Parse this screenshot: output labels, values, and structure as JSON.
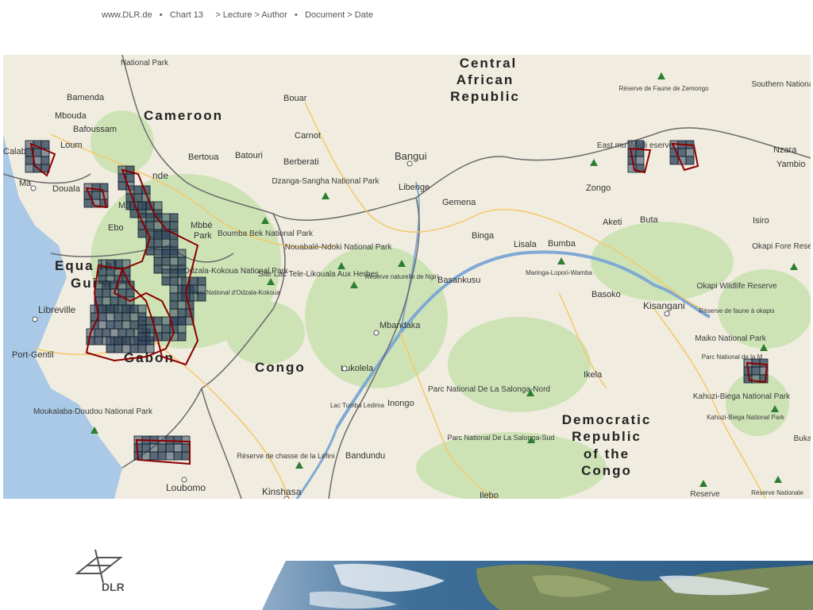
{
  "header": {
    "site": "www.DLR.de",
    "sep1": "•",
    "chart": "Chart 13",
    "lecture": "> Lecture > Author",
    "sep2": "•",
    "doc": "Document > Date"
  },
  "map": {
    "countries": [
      {
        "id": "central-african-republic",
        "lines": [
          "Central",
          "African",
          "Republic"
        ]
      },
      {
        "id": "cameroon",
        "lines": [
          "Cameroon"
        ]
      },
      {
        "id": "equatorial-guinea",
        "lines": [
          "Equa    ial",
          "Gui   a"
        ]
      },
      {
        "id": "gabon",
        "lines": [
          "Gabon"
        ]
      },
      {
        "id": "congo",
        "lines": [
          "Congo"
        ]
      },
      {
        "id": "drc",
        "lines": [
          "Democratic",
          "Republic",
          "of the",
          "Congo"
        ]
      }
    ],
    "cities": [
      "Bangui",
      "Bamenda",
      "Mbouda",
      "Bafoussam",
      "Loum",
      "Douala",
      "Calab",
      "Ma",
      "Bertoua",
      "Batouri",
      "Bouar",
      "Carnot",
      "Berberati",
      "Libenge",
      "Gemena",
      "Zongo",
      "Binga",
      "Lisala",
      "Bumba",
      "Aketi",
      "Buta",
      "Isiro",
      "Nzara",
      "Yambio",
      "Basankusu",
      "Basoko",
      "Kisangani",
      "Mbandaka",
      "Lukolela",
      "Inongo",
      "Ikela",
      "Libreville",
      "Port-Gentil",
      "Bandundu",
      "Kinshasa",
      "Loubomo",
      "Ilebo",
      "nde",
      "Mb",
      "Ebo",
      "Mbbé",
      "Park",
      "Mbandaka"
    ],
    "parks": [
      "National Park",
      "Dzanga-Sangha National Park",
      "Boumba Bek National Park",
      "Nouabalé-Ndoki National Park",
      "Site Lac Tele-Likouala Aux Herbes",
      "Odzala-Kokoua National Park",
      "Parc National d'Odzala-Kokoua",
      "Réserve naturelle de Ngiri",
      "Maringa-Lopori-Wamba",
      "Okapi Fore Reserve",
      "Okapi Wildlife Reserve",
      "Réserve de faune à okapis",
      "Maiko National Park",
      "Parc National de la M",
      "Kahuzi-Biega National Park",
      "Kahuzi-Biega National Park",
      "Parc National De La Salonga-Nord",
      "Parc National De La Salonga-Sud",
      "Moukalaba-Doudou National Park",
      "Réserve de chasse de la Léfini",
      "Lac Tumba Ledima",
      "Réserve de Faune de Zemongo",
      "Southern National Pa",
      "East  mu Wildli eserve",
      "Reserve",
      "Réserve Nationale",
      "Buka"
    ]
  },
  "colors": {
    "land": "#f1ece0",
    "forest": "#cde3b6",
    "water": "#a9c9e6",
    "river": "#7fa9d4",
    "border": "#6b6b6b",
    "road": "#f3c86a",
    "tile": "#34495e",
    "tile_stroke": "#0d1a26",
    "outline": "#8b0000"
  },
  "logo": {
    "text": "DLR"
  }
}
